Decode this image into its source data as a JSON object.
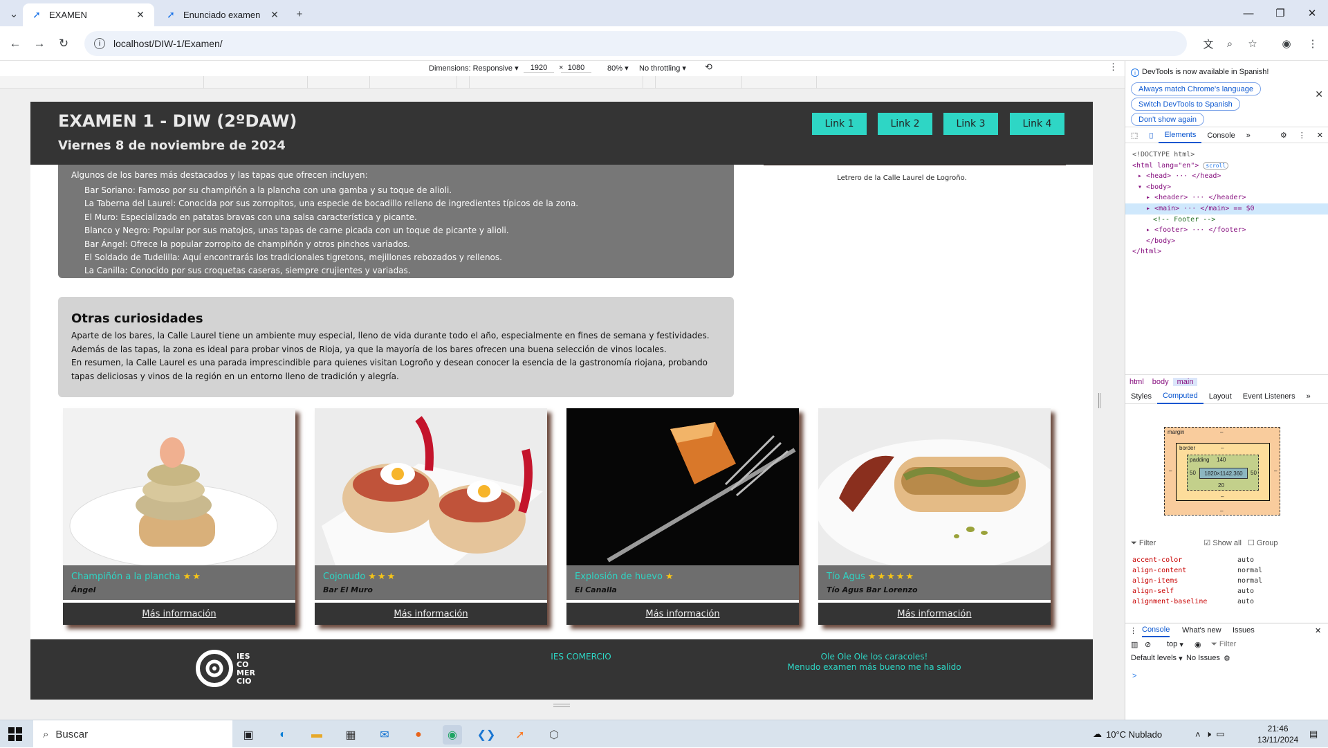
{
  "browser": {
    "tabs": [
      {
        "title": "EXAMEN",
        "active": true
      },
      {
        "title": "Enunciado examen",
        "active": false
      }
    ],
    "url": "localhost/DIW-1/Examen/"
  },
  "device_toolbar": {
    "dimensions_label": "Dimensions: Responsive",
    "width": "1920",
    "times": "×",
    "height": "1080",
    "zoom": "80%",
    "throttling": "No throttling"
  },
  "site": {
    "header_title": "EXAMEN 1 - DIW (2ºDAW)",
    "header_date": "Viernes 8 de noviembre de 2024",
    "nav": [
      "Link 1",
      "Link 2",
      "Link 3",
      "Link 4"
    ],
    "bars_intro": "Algunos de los bares más destacados y las tapas que ofrecen incluyen:",
    "bars": [
      "Bar Soriano: Famoso por su champiñón a la plancha con una gamba y su toque de alioli.",
      "La Taberna del Laurel: Conocida por sus zorropitos, una especie de bocadillo relleno de ingredientes típicos de la zona.",
      "El Muro: Especializado en patatas bravas con una salsa característica y picante.",
      "Blanco y Negro: Popular por sus matojos, unas tapas de carne picada con un toque de picante y alioli.",
      "Bar Ángel: Ofrece la popular zorropito de champiñón y otros pinchos variados.",
      "El Soldado de Tudelilla: Aquí encontrarás los tradicionales tigretons, mejillones rebozados y rellenos.",
      "La Canilla: Conocido por sus croquetas caseras, siempre crujientes y variadas."
    ],
    "figure_caption": "Letrero de la Calle Laurel de Logroño.",
    "curiosities_title": "Otras curiosidades",
    "curiosities_p1": "Aparte de los bares, la Calle Laurel tiene un ambiente muy especial, lleno de vida durante todo el año, especialmente en fines de semana y festividades. Además de las tapas, la zona es ideal para probar vinos de Rioja, ya que la mayoría de los bares ofrecen una buena selección de vinos locales.",
    "curiosities_p2": "En resumen, la Calle Laurel es una parada imprescindible para quienes visitan Logroño y desean conocer la esencia de la gastronomía riojana, probando tapas deliciosas y vinos de la región en un entorno lleno de tradición y alegría.",
    "cards": [
      {
        "title": "Champiñón a la plancha",
        "stars": "★★",
        "bar": "Ángel",
        "more": "Más información"
      },
      {
        "title": "Cojonudo",
        "stars": "★★★",
        "bar": "Bar El Muro",
        "more": "Más información"
      },
      {
        "title": "Explosión de huevo",
        "stars": "★",
        "bar": "El Canalla",
        "more": "Más información"
      },
      {
        "title": "Tío Agus",
        "stars": "★★★★★",
        "bar": "Tío Agus Bar Lorenzo",
        "more": "Más información"
      }
    ],
    "footer": {
      "logo_text": "IES CO MER CIO",
      "center": "IES COMERCIO",
      "right_line1": "Ole Ole Ole los caracoles!",
      "right_line2": "Menudo examen más bueno me ha salido"
    }
  },
  "devtools": {
    "notice": "DevTools is now available in Spanish!",
    "btn_match": "Always match Chrome's language",
    "btn_switch": "Switch DevTools to Spanish",
    "btn_dont": "Don't show again",
    "tabs": [
      "Elements",
      "Console"
    ],
    "dom": {
      "doctype": "<!DOCTYPE html>",
      "html_open": "<html lang=\"en\">",
      "scroll_badge": "scroll",
      "head": "<head> ··· </head>",
      "body_open": "<body>",
      "header": "<header> ··· </header>",
      "main": "<main> ··· </main> == $0",
      "comment": "<!-- Footer -->",
      "footer": "<footer> ··· </footer>",
      "body_close": "</body>",
      "html_close": "</html>"
    },
    "crumbs": [
      "html",
      "body",
      "main"
    ],
    "style_tabs": [
      "Styles",
      "Computed",
      "Layout",
      "Event Listeners"
    ],
    "box": {
      "margin": "margin",
      "margin_top": "–",
      "margin_bottom": "–",
      "border": "border",
      "border_top": "–",
      "border_bottom": "–",
      "padding": "padding",
      "padding_top": "140",
      "padding_bottom": "20",
      "padding_left": "50",
      "padding_right": "50",
      "content": "1820×1142.360",
      "dash_left": "–",
      "dash_right": "–"
    },
    "filter": "Filter",
    "show_all": "Show all",
    "group": "Group",
    "props": [
      {
        "k": "accent-color",
        "v": "auto"
      },
      {
        "k": "align-content",
        "v": "normal"
      },
      {
        "k": "align-items",
        "v": "normal"
      },
      {
        "k": "align-self",
        "v": "auto"
      },
      {
        "k": "alignment-baseline",
        "v": "auto"
      }
    ],
    "drawer_tabs": [
      "Console",
      "What's new",
      "Issues"
    ],
    "context": "top",
    "console_filter": "Filter",
    "levels": "Default levels",
    "issues": "No Issues",
    "prompt": ">"
  },
  "taskbar": {
    "search": "Buscar",
    "weather": "10°C  Nublado",
    "time": "21:46",
    "date": "13/11/2024"
  },
  "colors": {
    "accent": "#2ed6c5",
    "header_bg": "#343434",
    "star": "#f5c518"
  }
}
